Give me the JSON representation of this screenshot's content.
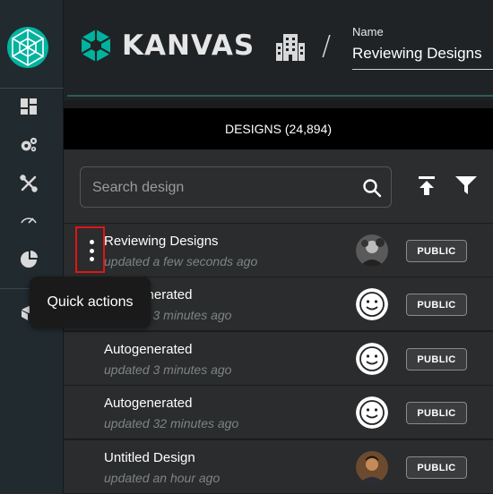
{
  "brand": {
    "name": "KANVAS",
    "accent": "#00b39f"
  },
  "header": {
    "name_label": "Name",
    "name_value": "Reviewing Designs",
    "separator": "/"
  },
  "designs": {
    "title": "DESIGNS (24,894)"
  },
  "search": {
    "placeholder": "Search design"
  },
  "rows": [
    {
      "title": "Reviewing Designs",
      "updated": "updated a few seconds ago",
      "visibility": "PUBLIC",
      "avatar": "user-photo"
    },
    {
      "title": "Autogenerated",
      "updated": "updated 3 minutes ago",
      "visibility": "PUBLIC",
      "avatar": "meshery-face"
    },
    {
      "title": "Autogenerated",
      "updated": "updated 3 minutes ago",
      "visibility": "PUBLIC",
      "avatar": "meshery-face"
    },
    {
      "title": "Autogenerated",
      "updated": "updated 32 minutes ago",
      "visibility": "PUBLIC",
      "avatar": "meshery-face"
    },
    {
      "title": "Untitled Design",
      "updated": "updated an hour ago",
      "visibility": "PUBLIC",
      "avatar": "user-photo"
    }
  ],
  "tooltip": {
    "text": "Quick actions"
  },
  "colors": {
    "highlight": "#e01515",
    "bar": "#000000"
  }
}
